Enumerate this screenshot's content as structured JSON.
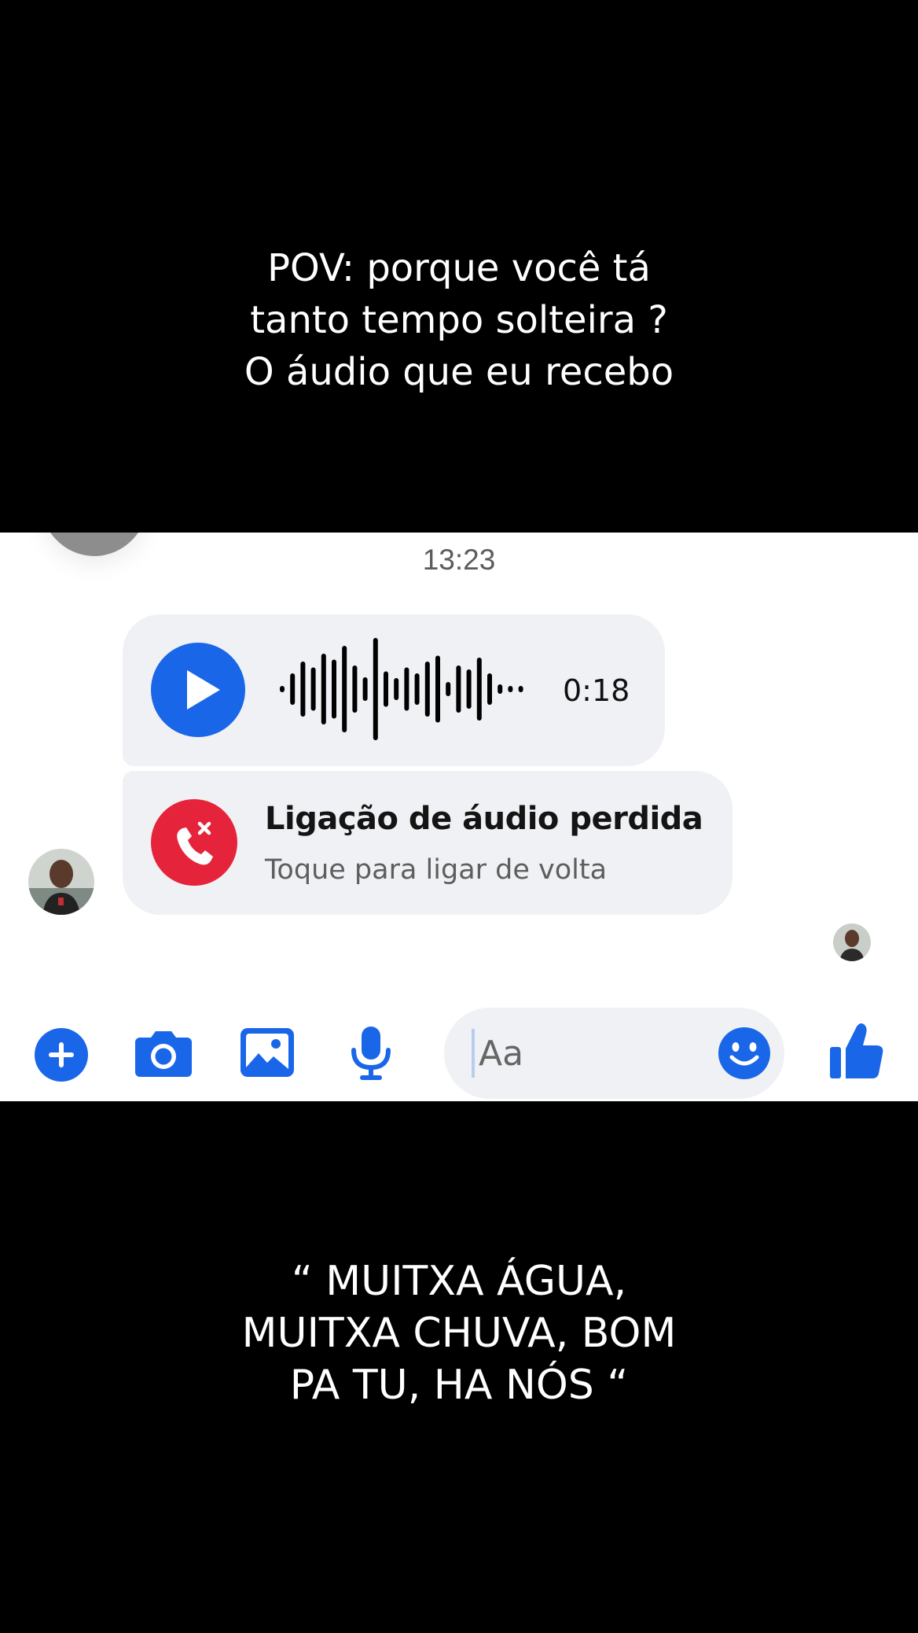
{
  "caption_top": {
    "line1": "POV: porque você tá",
    "line2": "tanto tempo solteira ?",
    "line3": "O áudio que eu recebo"
  },
  "chat": {
    "timestamp": "13:23",
    "voice_message": {
      "duration": "0:18",
      "play_icon": "play-icon",
      "accent_color": "#1a66e9"
    },
    "missed_call": {
      "title": "Ligação de áudio perdida",
      "subtitle": "Toque para ligar de volta",
      "icon": "missed-call-icon",
      "accent_color": "#e5243b"
    },
    "composer": {
      "placeholder": "Aa",
      "icons": [
        "plus-icon",
        "camera-icon",
        "image-icon",
        "microphone-icon",
        "emoji-icon",
        "thumbs-up-icon"
      ]
    }
  },
  "caption_bottom": {
    "line1": "“ MUITXA ÁGUA,",
    "line2": "MUITXA CHUVA, BOM",
    "line3": "PA TU, HA NÓS “"
  }
}
